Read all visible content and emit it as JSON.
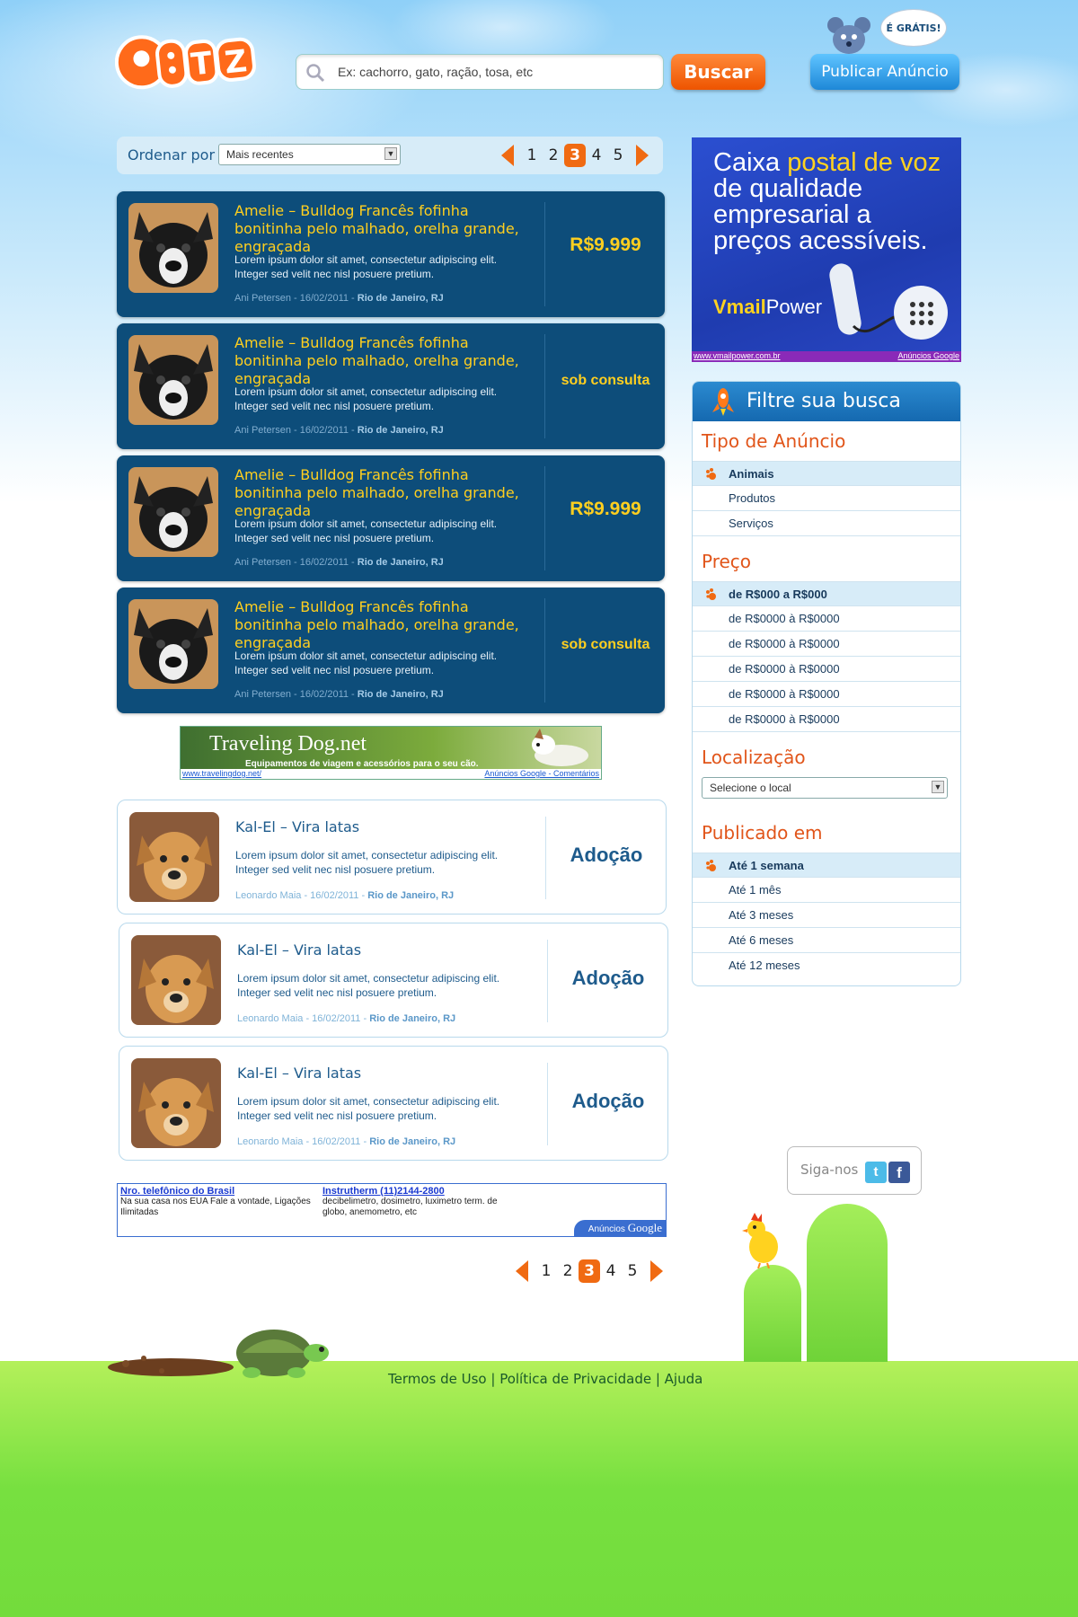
{
  "header": {
    "logo_text": "PETZ",
    "search_placeholder": "Ex: cachorro, gato, ração, tosa, etc",
    "search_button": "Buscar",
    "publish_button": "Publicar Anúncio",
    "free_badge": "É GRÁTIS!"
  },
  "sort": {
    "label": "Ordenar por",
    "selected": "Mais recentes"
  },
  "pagination": {
    "pages": [
      "1",
      "2",
      "3",
      "4",
      "5"
    ],
    "current": "3"
  },
  "featured_listings": [
    {
      "title": "Amelie – Bulldog Francês fofinha bonitinha pelo malhado, orelha grande, engraçada",
      "description": "Lorem ipsum dolor sit amet, consectetur adipiscing elit. Integer sed velit nec nisl posuere pretium.",
      "author_date": "Ani Petersen - 16/02/2011 - ",
      "location": "Rio de Janeiro, RJ",
      "price": "R$9.999"
    },
    {
      "title": "Amelie – Bulldog Francês fofinha bonitinha pelo malhado, orelha grande, engraçada",
      "description": "Lorem ipsum dolor sit amet, consectetur adipiscing elit. Integer sed velit nec nisl posuere pretium.",
      "author_date": "Ani Petersen - 16/02/2011 - ",
      "location": "Rio de Janeiro, RJ",
      "price": "sob consulta"
    },
    {
      "title": "Amelie – Bulldog Francês fofinha bonitinha pelo malhado, orelha grande, engraçada",
      "description": "Lorem ipsum dolor sit amet, consectetur adipiscing elit. Integer sed velit nec nisl posuere pretium.",
      "author_date": "Ani Petersen - 16/02/2011 - ",
      "location": "Rio de Janeiro, RJ",
      "price": "R$9.999"
    },
    {
      "title": "Amelie – Bulldog Francês fofinha bonitinha pelo malhado, orelha grande, engraçada",
      "description": "Lorem ipsum dolor sit amet, consectetur adipiscing elit. Integer sed velit nec nisl posuere pretium.",
      "author_date": "Ani Petersen - 16/02/2011 - ",
      "location": "Rio de Janeiro, RJ",
      "price": "sob consulta"
    }
  ],
  "regular_listings": [
    {
      "title": "Kal-El – Vira latas",
      "description": "Lorem ipsum dolor sit amet, consectetur adipiscing elit. Integer sed velit nec nisl posuere pretium.",
      "author_date": "Leonardo Maia - 16/02/2011 - ",
      "location": "Rio de Janeiro, RJ",
      "price": "Adoção"
    },
    {
      "title": "Kal-El – Vira latas",
      "description": "Lorem ipsum dolor sit amet, consectetur adipiscing elit. Integer sed velit nec nisl posuere pretium.",
      "author_date": "Leonardo Maia - 16/02/2011 - ",
      "location": "Rio de Janeiro, RJ",
      "price": "Adoção"
    },
    {
      "title": "Kal-El – Vira latas",
      "description": "Lorem ipsum dolor sit amet, consectetur adipiscing elit. Integer sed velit nec nisl posuere pretium.",
      "author_date": "Leonardo Maia - 16/02/2011 - ",
      "location": "Rio de Janeiro, RJ",
      "price": "Adoção"
    }
  ],
  "ad_travel": {
    "brand": "Traveling Dog.net",
    "tagline": "Equipamentos de viagem e acessórios para o seu cão.",
    "url": "www.travelingdog.net/",
    "footer": "Anúncios Google - Comentários"
  },
  "ad_text": {
    "ad1_title": "Nro. telefônico do Brasil",
    "ad1_text": "Na sua casa nos EUA Fale a vontade, Ligações Ilimitadas",
    "ad2_title": "Instrutherm (11)2144-2800",
    "ad2_text": "decibelimetro, dosimetro, luximetro term. de globo, anemometro, etc",
    "footer_label": "Anúncios",
    "footer_brand": "Google"
  },
  "ad_vmail": {
    "line_a": "Caixa ",
    "line_b": "postal de voz",
    "line_c": " de qualidade empresarial a preços acessíveis.",
    "brand_a": "Vmail",
    "brand_b": "Power",
    "url": "www.vmailpower.com.br",
    "footer": "Anúncios Google"
  },
  "filters": {
    "title": "Filtre sua busca",
    "tipo_label": "Tipo de Anúncio",
    "tipo_items": [
      "Animais",
      "Produtos",
      "Serviços"
    ],
    "preco_label": "Preço",
    "preco_items": [
      "de R$000 a R$000",
      "de R$0000 à R$0000",
      "de R$0000 à R$0000",
      "de R$0000 à R$0000",
      "de R$0000 à R$0000",
      "de R$0000 à R$0000"
    ],
    "local_label": "Localização",
    "local_placeholder": "Selecione o local",
    "publicado_label": "Publicado em",
    "publicado_items": [
      "Até 1 semana",
      "Até 1 mês",
      "Até 3 meses",
      "Até 6 meses",
      "Até 12 meses"
    ]
  },
  "social": {
    "label": "Siga-nos"
  },
  "footer": {
    "terms": "Termos de Uso",
    "privacy": "Política de Privacidade",
    "help": "Ajuda",
    "separator": " | "
  },
  "colors": {
    "accent_orange": "#f06a12",
    "dark_card": "#0d4d7a",
    "title_yellow": "#ffcf1f",
    "text_blue": "#1e5b8c",
    "ground_green": "#77e040"
  }
}
